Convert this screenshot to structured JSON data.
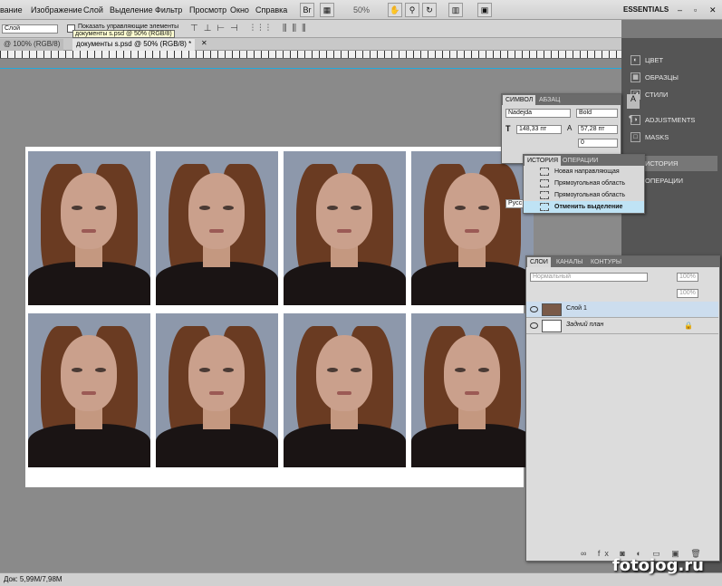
{
  "menu": [
    "вание",
    "Изображение",
    "Слой",
    "Выделение",
    "Фильтр",
    "Просмотр",
    "Окно",
    "Справка"
  ],
  "toolbar": {
    "br": "Br",
    "zoom": "50%",
    "workspace": "ESSENTIALS",
    "win_min": "–",
    "win_max": "▫",
    "win_close": "✕"
  },
  "options": {
    "tool_value": "Слой",
    "checkbox_label": "Показать управляющие элементы",
    "tooltip": "документы s.psd @ 50% (RGB/8)"
  },
  "tabs": [
    {
      "label": "@ 100% (RGB/8)"
    },
    {
      "label": "документы s.psd @ 50% (RGB/8) *"
    }
  ],
  "status": {
    "doc": "Док: 5,99M/7,98M"
  },
  "dock": {
    "items": [
      "ЦВЕТ",
      "ОБРАЗЦЫ",
      "СТИЛИ",
      "ADJUSTMENTS",
      "MASKS",
      "ИСТОРИЯ",
      "ОПЕРАЦИИ"
    ]
  },
  "char_panel": {
    "tabs": [
      "СИМВОЛ",
      "АБЗАЦ"
    ],
    "font": "Nadejda",
    "style": "Bold",
    "size": "148,33 пт",
    "leading": "57,28 пт",
    "tracking": "0",
    "lang": "Русс"
  },
  "history_panel": {
    "tabs": [
      "ИСТОРИЯ",
      "ОПЕРАЦИИ"
    ],
    "items": [
      "Новая направляющая",
      "Прямоугольная область",
      "Прямоугольная область",
      "Отменить выделение"
    ]
  },
  "layers_panel": {
    "tabs": [
      "СЛОИ",
      "КАНАЛЫ",
      "КОНТУРЫ"
    ],
    "blend": "Нормальный",
    "opacity": "100%",
    "fill": "100%",
    "layers": [
      "Слой 1",
      "Задний план"
    ]
  },
  "watermark": "fotojog.ru",
  "colors": {
    "selected": "#bfe3f5",
    "bg": "#8d98ab"
  }
}
